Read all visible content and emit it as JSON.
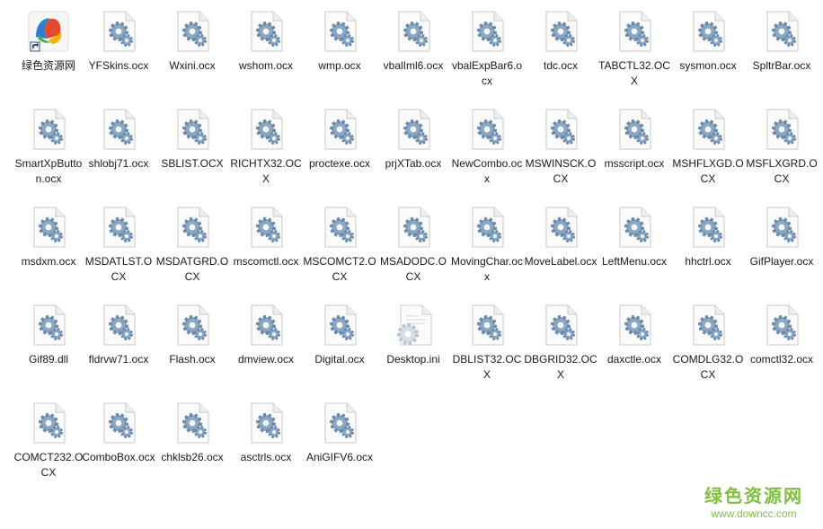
{
  "files": [
    {
      "name": "绿色资源网",
      "icon": "shortcut-app-icon"
    },
    {
      "name": "YFSkins.ocx",
      "icon": "system-file-gear-icon"
    },
    {
      "name": "Wxini.ocx",
      "icon": "system-file-gear-icon"
    },
    {
      "name": "wshom.ocx",
      "icon": "system-file-gear-icon"
    },
    {
      "name": "wmp.ocx",
      "icon": "system-file-gear-icon"
    },
    {
      "name": "vbalIml6.ocx",
      "icon": "system-file-gear-icon"
    },
    {
      "name": "vbalExpBar6.ocx",
      "icon": "system-file-gear-icon"
    },
    {
      "name": "tdc.ocx",
      "icon": "system-file-gear-icon"
    },
    {
      "name": "TABCTL32.OCX",
      "icon": "system-file-gear-icon"
    },
    {
      "name": "sysmon.ocx",
      "icon": "system-file-gear-icon"
    },
    {
      "name": "SpltrBar.ocx",
      "icon": "system-file-gear-icon"
    },
    {
      "name": "SmartXpButton.ocx",
      "icon": "system-file-gear-icon"
    },
    {
      "name": "shlobj71.ocx",
      "icon": "system-file-gear-icon"
    },
    {
      "name": "SBLIST.OCX",
      "icon": "system-file-gear-icon"
    },
    {
      "name": "RICHTX32.OCX",
      "icon": "system-file-gear-icon"
    },
    {
      "name": "proctexe.ocx",
      "icon": "system-file-gear-icon"
    },
    {
      "name": "prjXTab.ocx",
      "icon": "system-file-gear-icon"
    },
    {
      "name": "NewCombo.ocx",
      "icon": "system-file-gear-icon"
    },
    {
      "name": "MSWINSCK.OCX",
      "icon": "system-file-gear-icon"
    },
    {
      "name": "msscript.ocx",
      "icon": "system-file-gear-icon"
    },
    {
      "name": "MSHFLXGD.OCX",
      "icon": "system-file-gear-icon"
    },
    {
      "name": "MSFLXGRD.OCX",
      "icon": "system-file-gear-icon"
    },
    {
      "name": "msdxm.ocx",
      "icon": "system-file-gear-icon"
    },
    {
      "name": "MSDATLST.OCX",
      "icon": "system-file-gear-icon"
    },
    {
      "name": "MSDATGRD.OCX",
      "icon": "system-file-gear-icon"
    },
    {
      "name": "mscomctl.ocx",
      "icon": "system-file-gear-icon"
    },
    {
      "name": "MSCOMCT2.OCX",
      "icon": "system-file-gear-icon"
    },
    {
      "name": "MSADODC.OCX",
      "icon": "system-file-gear-icon"
    },
    {
      "name": "MovingChar.ocx",
      "icon": "system-file-gear-icon"
    },
    {
      "name": "MoveLabel.ocx",
      "icon": "system-file-gear-icon"
    },
    {
      "name": "LeftMenu.ocx",
      "icon": "system-file-gear-icon"
    },
    {
      "name": "hhctrl.ocx",
      "icon": "system-file-gear-icon"
    },
    {
      "name": "GifPlayer.ocx",
      "icon": "system-file-gear-icon"
    },
    {
      "name": "Gif89.dll",
      "icon": "system-file-gear-icon"
    },
    {
      "name": "fldrvw71.ocx",
      "icon": "system-file-gear-icon"
    },
    {
      "name": "Flash.ocx",
      "icon": "system-file-gear-icon"
    },
    {
      "name": "dmview.ocx",
      "icon": "system-file-gear-icon"
    },
    {
      "name": "Digital.ocx",
      "icon": "system-file-gear-icon"
    },
    {
      "name": "Desktop.ini",
      "icon": "settings-file-gear-icon"
    },
    {
      "name": "DBLIST32.OCX",
      "icon": "system-file-gear-icon"
    },
    {
      "name": "DBGRID32.OCX",
      "icon": "system-file-gear-icon"
    },
    {
      "name": "daxctle.ocx",
      "icon": "system-file-gear-icon"
    },
    {
      "name": "COMDLG32.OCX",
      "icon": "system-file-gear-icon"
    },
    {
      "name": "comctl32.ocx",
      "icon": "system-file-gear-icon"
    },
    {
      "name": "COMCT232.OCX",
      "icon": "system-file-gear-icon"
    },
    {
      "name": "ComboBox.ocx",
      "icon": "system-file-gear-icon"
    },
    {
      "name": "chklsb26.ocx",
      "icon": "system-file-gear-icon"
    },
    {
      "name": "asctrls.ocx",
      "icon": "system-file-gear-icon"
    },
    {
      "name": "AniGIFV6.ocx",
      "icon": "system-file-gear-icon"
    }
  ],
  "watermark": {
    "text": "绿色资源网",
    "url": "www.downcc.com"
  },
  "colors": {
    "watermark": "#7fbf3f",
    "label": "#1a1a1a",
    "gear": "#8aa7c4"
  }
}
